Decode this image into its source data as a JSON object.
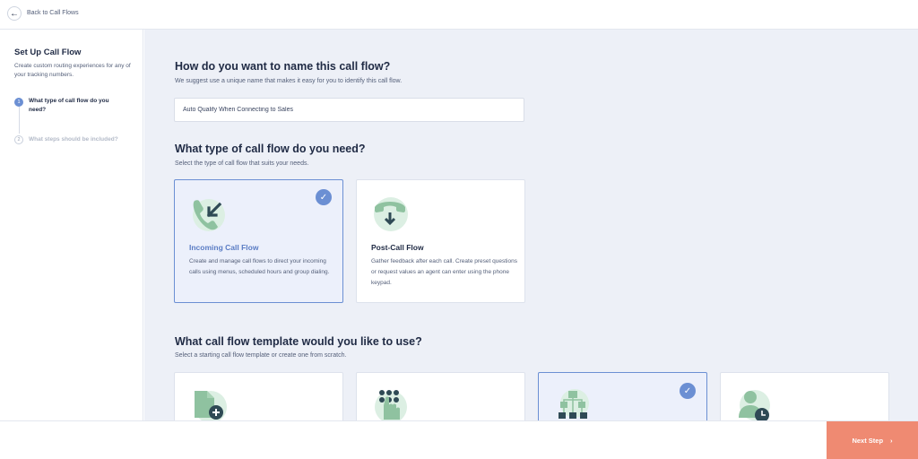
{
  "topbar": {
    "back_label": "Back to Call Flows",
    "back_icon": "arrow-left-icon"
  },
  "sidebar": {
    "title": "Set Up Call Flow",
    "description": "Create custom routing experiences for any of your tracking numbers.",
    "steps": [
      {
        "number": "1",
        "label": "What type of call flow do you need?",
        "state": "active"
      },
      {
        "number": "2",
        "label": "What steps should be included?",
        "state": "inactive"
      }
    ]
  },
  "name_section": {
    "heading": "How do you want to name this call flow?",
    "subheading": "We suggest use a unique name that makes it easy for you to identify this call flow.",
    "input_value": "Auto Qualify When Connecting to Sales"
  },
  "type_section": {
    "heading": "What type of call flow do you need?",
    "subheading": "Select the type of call flow that suits your needs.",
    "cards": [
      {
        "title": "Incoming Call Flow",
        "description": "Create and manage call flows to direct your incoming calls using menus, scheduled hours and group dialing.",
        "icon": "incoming-call-icon",
        "selected": true
      },
      {
        "title": "Post-Call Flow",
        "description": "Gather feedback after each call. Create preset questions or request values an agent can enter using the phone keypad.",
        "icon": "phone-download-icon",
        "selected": false
      }
    ]
  },
  "template_section": {
    "heading": "What call flow template would you like to use?",
    "subheading": "Select a starting call flow template or create one from scratch.",
    "cards": [
      {
        "icon": "new-document-icon",
        "selected": false
      },
      {
        "icon": "keypad-icon",
        "selected": false
      },
      {
        "icon": "hierarchy-icon",
        "selected": true
      },
      {
        "icon": "user-clock-icon",
        "selected": false
      }
    ]
  },
  "footer": {
    "next_label": "Next Step"
  },
  "colors": {
    "accent": "#6b8fd3",
    "cta": "#ef8a72",
    "icon_green": "#8fc2a0",
    "icon_dark": "#2f4a55",
    "main_bg": "#edf0f7"
  }
}
